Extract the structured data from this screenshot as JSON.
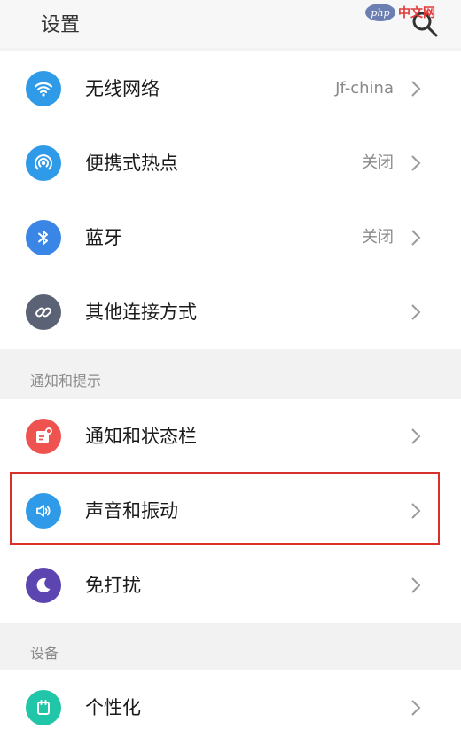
{
  "header": {
    "title": "设置"
  },
  "watermark": {
    "logo": "php",
    "text": "中文网"
  },
  "group1": {
    "items": [
      {
        "label": "无线网络",
        "value": "Jf-china",
        "icon": "wifi-icon",
        "color": "#2f9be8"
      },
      {
        "label": "便携式热点",
        "value": "关闭",
        "icon": "hotspot-icon",
        "color": "#2f9be8"
      },
      {
        "label": "蓝牙",
        "value": "关闭",
        "icon": "bluetooth-icon",
        "color": "#3a86e6"
      },
      {
        "label": "其他连接方式",
        "value": "",
        "icon": "link-icon",
        "color": "#5b6275"
      }
    ]
  },
  "section2": {
    "title": "通知和提示"
  },
  "group2": {
    "items": [
      {
        "label": "通知和状态栏",
        "value": "",
        "icon": "notification-icon",
        "color": "#ef5350"
      },
      {
        "label": "声音和振动",
        "value": "",
        "icon": "sound-icon",
        "color": "#2f9be8"
      },
      {
        "label": "免打扰",
        "value": "",
        "icon": "moon-icon",
        "color": "#5c45b0"
      }
    ]
  },
  "section3": {
    "title": "设备"
  },
  "group3": {
    "items": [
      {
        "label": "个性化",
        "value": "",
        "icon": "personalize-icon",
        "color": "#20c6a7"
      }
    ]
  },
  "highlight_color": "#d9302c"
}
